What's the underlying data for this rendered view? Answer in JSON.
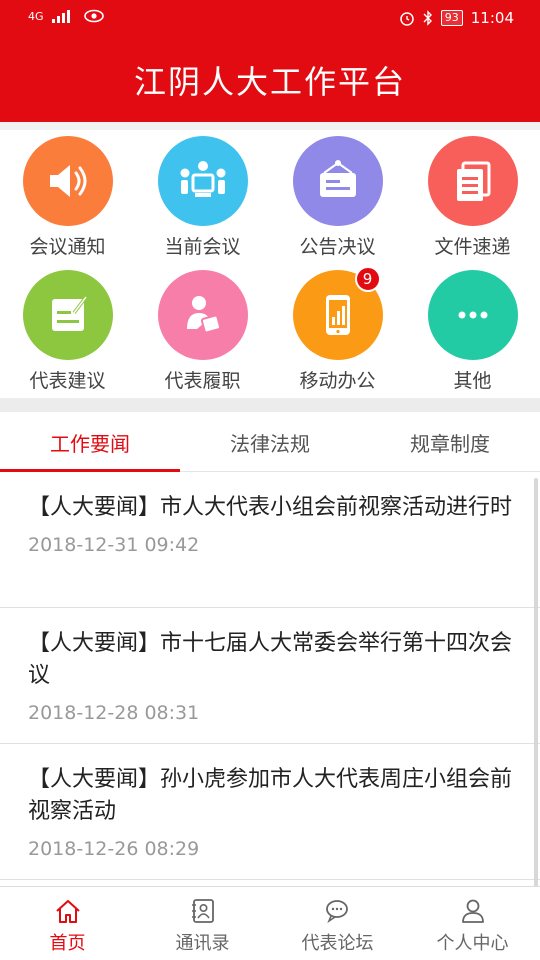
{
  "status_bar": {
    "network": "4G",
    "battery": "93",
    "time": "11:04"
  },
  "header": {
    "title": "江阴人大工作平台"
  },
  "grid": {
    "items": [
      {
        "label": "会议通知",
        "icon": "speaker-icon",
        "color": "#fb7d3c"
      },
      {
        "label": "当前会议",
        "icon": "meeting-icon",
        "color": "#3fc3ee"
      },
      {
        "label": "公告决议",
        "icon": "notice-board-icon",
        "color": "#9189e8"
      },
      {
        "label": "文件速递",
        "icon": "documents-icon",
        "color": "#f85f5b"
      },
      {
        "label": "代表建议",
        "icon": "edit-note-icon",
        "color": "#8dc63f"
      },
      {
        "label": "代表履职",
        "icon": "person-reading-icon",
        "color": "#f77ea8"
      },
      {
        "label": "移动办公",
        "icon": "tablet-chart-icon",
        "color": "#fb9a14",
        "badge": "9"
      },
      {
        "label": "其他",
        "icon": "more-dots-icon",
        "color": "#22cba3"
      }
    ]
  },
  "tabs": [
    {
      "label": "工作要闻",
      "active": true
    },
    {
      "label": "法律法规",
      "active": false
    },
    {
      "label": "规章制度",
      "active": false
    }
  ],
  "news": [
    {
      "title": "【人大要闻】市人大代表小组会前视察活动进行时",
      "date": "2018-12-31 09:42"
    },
    {
      "title": "【人大要闻】市十七届人大常委会举行第十四次会议",
      "date": "2018-12-28 08:31"
    },
    {
      "title": "【人大要闻】孙小虎参加市人大代表周庄小组会前视察活动",
      "date": "2018-12-26 08:29"
    }
  ],
  "bottom_nav": [
    {
      "label": "首页",
      "icon": "home-icon",
      "active": true
    },
    {
      "label": "通讯录",
      "icon": "contacts-icon",
      "active": false
    },
    {
      "label": "代表论坛",
      "icon": "chat-bubbles-icon",
      "active": false
    },
    {
      "label": "个人中心",
      "icon": "user-icon",
      "active": false
    }
  ],
  "colors": {
    "brand": "#e30b12"
  }
}
